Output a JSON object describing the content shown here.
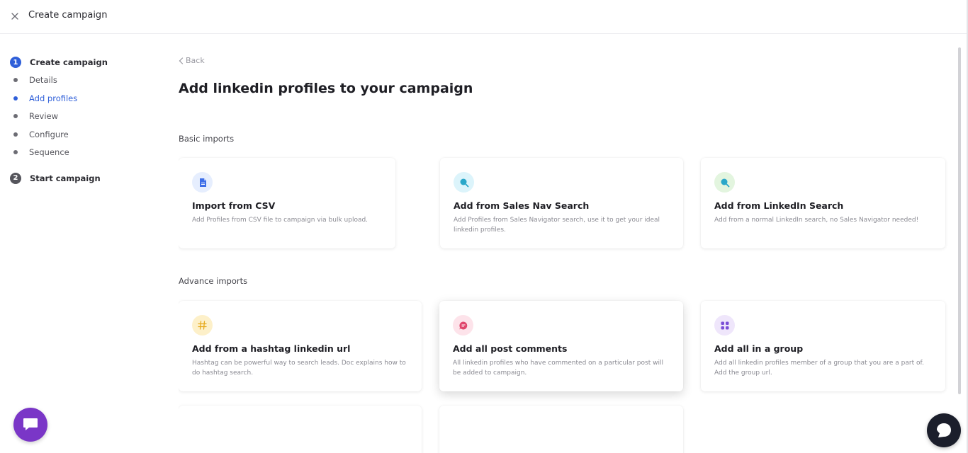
{
  "header": {
    "title": "Create campaign",
    "close_icon": "close-icon"
  },
  "stepper": {
    "step1": {
      "number": "1",
      "label": "Create campaign"
    },
    "substeps": [
      {
        "label": "Details"
      },
      {
        "label": "Add profiles"
      },
      {
        "label": "Review"
      },
      {
        "label": "Configure"
      },
      {
        "label": "Sequence"
      }
    ],
    "step2": {
      "number": "2",
      "label": "Start campaign"
    }
  },
  "main": {
    "back_label": "Back",
    "heading": "Add linkedin profiles to your campaign",
    "basic_label": "Basic imports",
    "advance_label": "Advance imports",
    "cards": [
      {
        "icon": "csv-file-icon",
        "title": "Import from CSV",
        "description": "Add Profiles from CSV file to campaign via bulk upload."
      },
      {
        "icon": "search-icon",
        "title": "Add from Sales Nav Search",
        "description": "Add Profiles from Sales Navigator search, use it to get your ideal linkedin profiles."
      },
      {
        "icon": "search-icon",
        "title": "Add from LinkedIn Search",
        "description": "Add from a normal LinkedIn search, no Sales Navigator needed!"
      },
      {
        "icon": "hashtag-icon",
        "title": "Add from a hashtag linkedin url",
        "description": "Hashtag can be powerful way to search leads. Doc explains how to do hashtag search."
      },
      {
        "icon": "comment-icon",
        "title": "Add all post comments",
        "description": "All linkedin profiles who have commented on a particular post will be added to campaign."
      },
      {
        "icon": "group-icon",
        "title": "Add all in a group",
        "description": "Add all linkedin profiles member of a group that you are a part of. Add the group url."
      }
    ]
  },
  "colors": {
    "accent": "#2f5fd9",
    "chat_left": "#7a36c7",
    "chat_right": "#1b1e2b",
    "csv_icon_bg": "#e6eefe",
    "salesnav_icon_bg": "#dcf4fb",
    "linkedin_icon_bg": "#e3f5df",
    "hashtag_icon_bg": "#fdf0c9",
    "comment_icon_bg": "#fde3ea",
    "group_icon_bg": "#efe6fb"
  }
}
